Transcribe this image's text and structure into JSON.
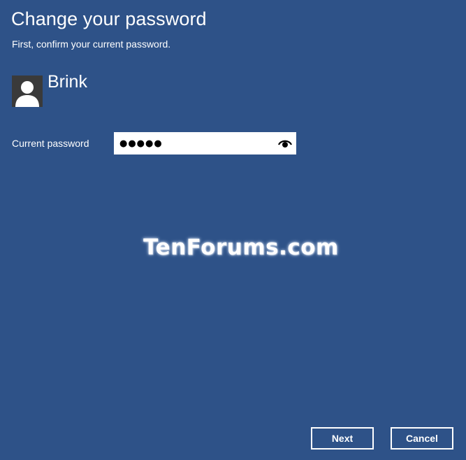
{
  "dialog": {
    "title": "Change your password",
    "subtitle": "First, confirm your current password."
  },
  "account": {
    "username": "Brink",
    "avatar_icon": "user-silhouette-icon"
  },
  "password_field": {
    "label": "Current password",
    "value": "●●●●●",
    "reveal_icon": "eye-icon"
  },
  "watermark": "TenForums.com",
  "buttons": {
    "next_label": "Next",
    "cancel_label": "Cancel"
  },
  "colors": {
    "background": "#2e5288",
    "text": "#ffffff",
    "avatar_bg": "#3a3a3a"
  }
}
